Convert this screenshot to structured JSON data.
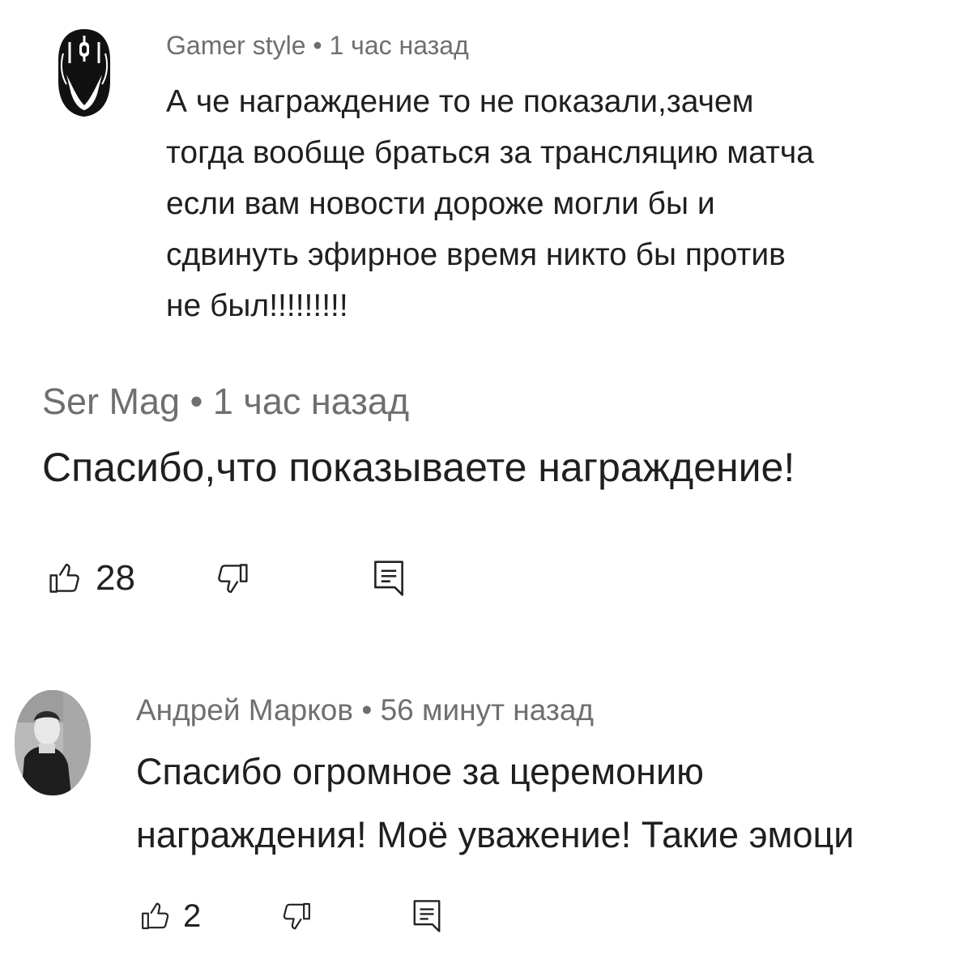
{
  "comments": [
    {
      "author": "Gamer style",
      "separator": "•",
      "time": "1 час назад",
      "avatar_icon": "gaming-mouse-icon",
      "text_lines": [
        "А че награждение то не показали,зачем",
        "тогда вообще браться за трансляцию матча",
        "если вам новости дороже могли бы и",
        "сдвинуть эфирное время никто бы против",
        "не был!!!!!!!!!"
      ]
    },
    {
      "author": "Ser Mag",
      "separator": "•",
      "time": "1 час назад",
      "text_lines": [
        "Спасибо,что показываете награждение!"
      ],
      "likes": "28",
      "like_icon": "thumbs-up-icon",
      "dislike_icon": "thumbs-down-icon",
      "reply_icon": "reply-comment-icon"
    },
    {
      "author": "Андрей Марков",
      "separator": "•",
      "time": "56 минут назад",
      "avatar_icon": "user-photo-avatar",
      "text_lines": [
        "Спасибо огромное за церемонию",
        "награждения! Моё уважение! Такие эмоци"
      ],
      "likes": "2",
      "like_icon": "thumbs-up-icon",
      "dislike_icon": "thumbs-down-icon",
      "reply_icon": "reply-comment-icon"
    }
  ],
  "colors": {
    "background": "#ffffff",
    "text": "#1f1f1f",
    "meta": "#6f6f6f"
  }
}
